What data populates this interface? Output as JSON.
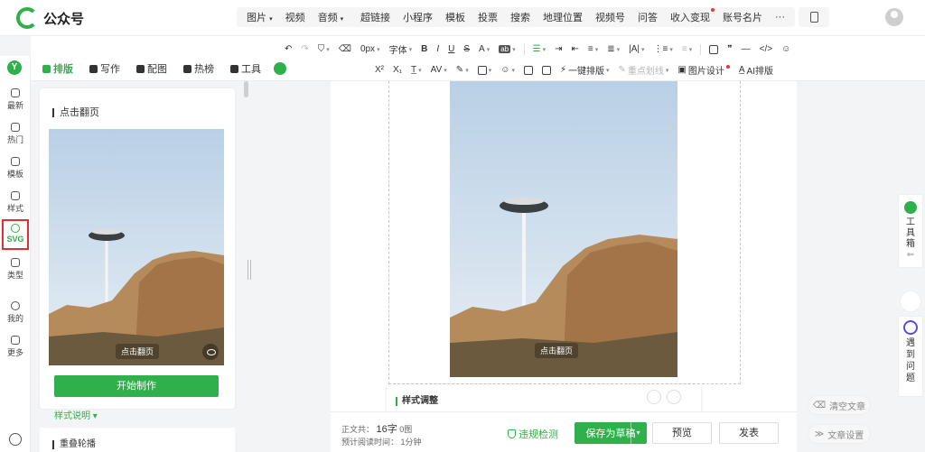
{
  "app": {
    "name": "公众号"
  },
  "topbar": {
    "media": [
      "图片",
      "视频",
      "音频"
    ],
    "inserts": [
      {
        "label": "超链接"
      },
      {
        "label": "小程序"
      },
      {
        "label": "模板"
      },
      {
        "label": "投票"
      },
      {
        "label": "搜索"
      },
      {
        "label": "地理位置"
      },
      {
        "label": "视频号"
      },
      {
        "label": "问答"
      },
      {
        "label": "收入变现",
        "dot": true
      },
      {
        "label": "账号名片"
      }
    ],
    "more": "···"
  },
  "tabs": [
    {
      "label": "排版",
      "icon": "layout-icon",
      "active": true
    },
    {
      "label": "写作",
      "icon": "pen-icon"
    },
    {
      "label": "配图",
      "icon": "image-icon"
    },
    {
      "label": "热榜",
      "icon": "bookmark-icon"
    },
    {
      "label": "工具",
      "icon": "cube-icon"
    }
  ],
  "format_row1": {
    "font_size": "0px",
    "font": "字体"
  },
  "format_row2": {
    "one_click": "一键排版",
    "highlight": "重点划线",
    "image_design": "图片设计",
    "ai_layout": "AI排版"
  },
  "rail": [
    {
      "label": "最新",
      "icon": "chat-icon"
    },
    {
      "label": "热门",
      "icon": "flame-icon"
    },
    {
      "label": "模板",
      "icon": "template-icon"
    },
    {
      "label": "样式",
      "icon": "style-icon"
    },
    {
      "label": "SVG",
      "icon": "svg-icon",
      "active": true
    },
    {
      "label": "类型",
      "icon": "books-icon"
    },
    {
      "label": "我的",
      "icon": "user-icon"
    },
    {
      "label": "更多",
      "icon": "grid-icon"
    }
  ],
  "panel": {
    "card_title": "点击翻页",
    "overlay_label": "点击翻页",
    "start_button": "开始制作",
    "style_note": "样式说明",
    "next_card_title": "重叠轮播"
  },
  "editor": {
    "overlay_label": "点击翻页",
    "style_panel_title": "样式调整"
  },
  "bottom": {
    "word_count_label": "正文共：",
    "word_count": "16字",
    "image_count": "0图",
    "read_time_label": "预计阅读时间：",
    "read_time": "1分钟",
    "violation_check": "违规检测",
    "save_draft": "保存为草稿",
    "preview": "预览",
    "publish": "发表"
  },
  "right": {
    "clear_article": "清空文章",
    "article_settings": "文章设置",
    "toolbox": [
      "工",
      "具",
      "箱"
    ],
    "problem": [
      "遇",
      "到",
      "问",
      "题"
    ]
  },
  "colors": {
    "accent": "#2fb04a",
    "highlight_border": "#e02f2f",
    "purple": "#5b4bd9"
  }
}
